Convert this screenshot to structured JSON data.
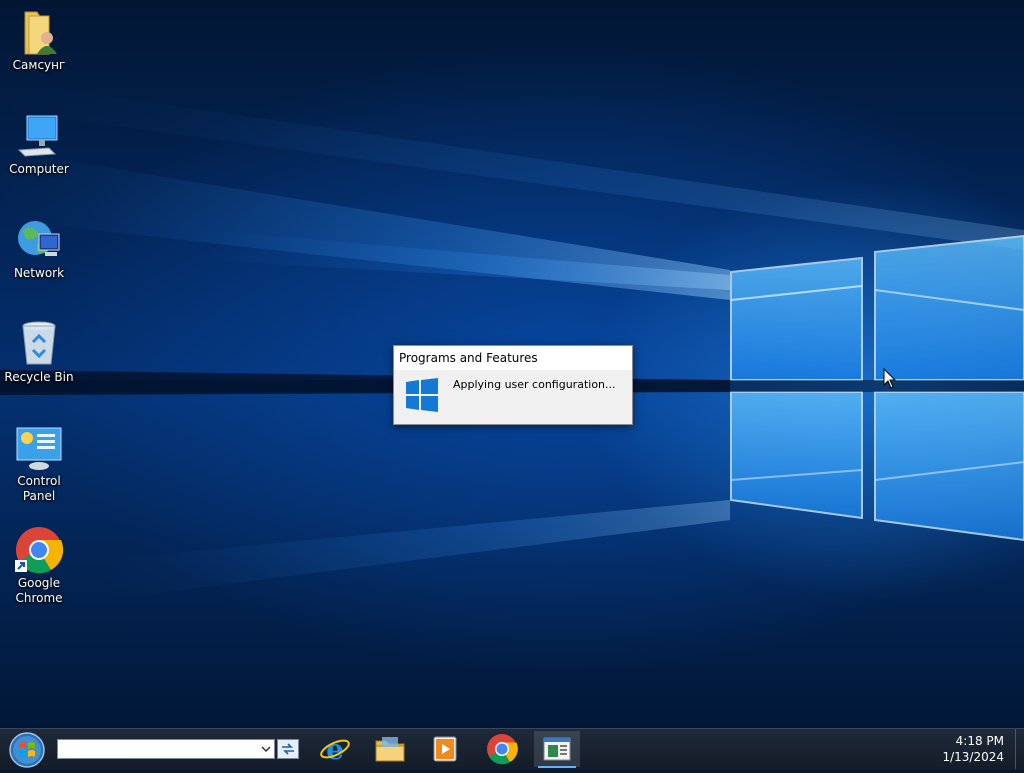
{
  "desktop": {
    "icons": [
      {
        "label": "Самсунг",
        "icon": "user-folder-icon"
      },
      {
        "label": "Computer",
        "icon": "computer-icon"
      },
      {
        "label": "Network",
        "icon": "network-icon"
      },
      {
        "label": "Recycle Bin",
        "icon": "recycle-bin-icon"
      },
      {
        "label": "Control Panel",
        "icon": "control-panel-icon"
      },
      {
        "label": "Google Chrome",
        "icon": "chrome-icon"
      }
    ]
  },
  "dialog": {
    "title": "Programs and Features",
    "message": "Applying user configuration..."
  },
  "taskbar": {
    "search_value": "",
    "pinned": [
      {
        "name": "internet-explorer",
        "icon": "ie-icon"
      },
      {
        "name": "file-explorer",
        "icon": "folder-icon"
      },
      {
        "name": "media-player",
        "icon": "media-player-icon"
      },
      {
        "name": "google-chrome",
        "icon": "chrome-icon"
      },
      {
        "name": "programs-and-features",
        "icon": "programs-features-icon",
        "active": true
      }
    ],
    "clock": {
      "time": "4:18 PM",
      "date": "1/13/2024"
    }
  },
  "colors": {
    "accent": "#0078d7",
    "taskbar": "#1a2433"
  }
}
